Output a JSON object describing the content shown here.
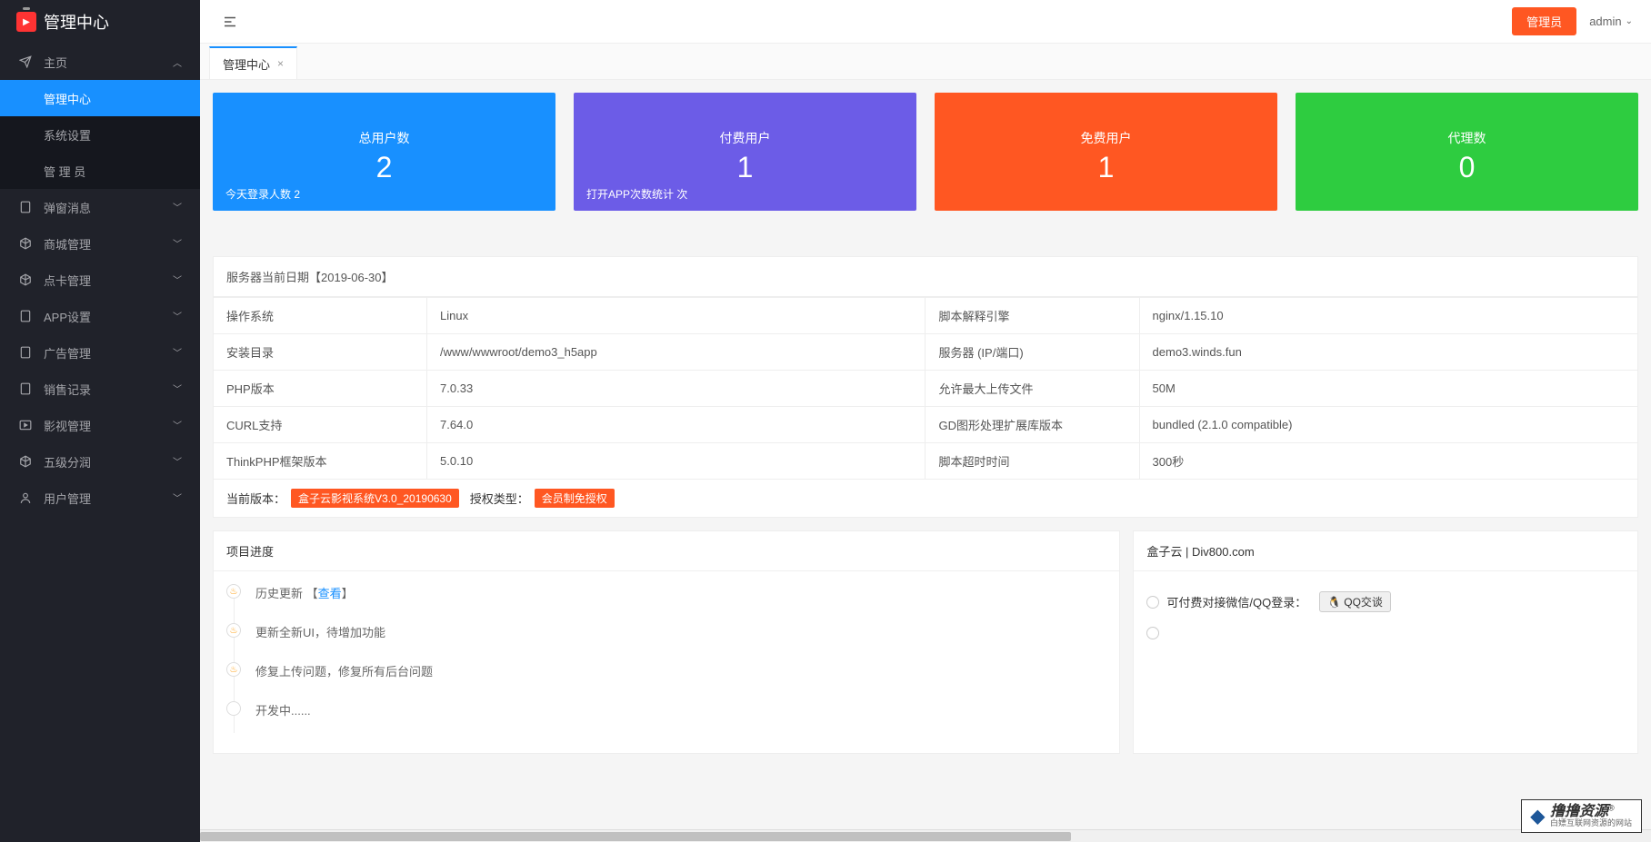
{
  "logo": {
    "title": "管理中心"
  },
  "sidebar": {
    "home": {
      "label": "主页",
      "expanded": true
    },
    "home_children": [
      {
        "label": "管理中心",
        "active": true
      },
      {
        "label": "系统设置"
      },
      {
        "label": "管 理 员"
      }
    ],
    "items": [
      {
        "label": "弹窗消息"
      },
      {
        "label": "商城管理"
      },
      {
        "label": "点卡管理"
      },
      {
        "label": "APP设置"
      },
      {
        "label": "广告管理"
      },
      {
        "label": "销售记录"
      },
      {
        "label": "影视管理"
      },
      {
        "label": "五级分润"
      },
      {
        "label": "用户管理"
      }
    ]
  },
  "topbar": {
    "admin_btn": "管理员",
    "user": "admin"
  },
  "tabs": [
    {
      "label": "管理中心",
      "closable": true,
      "active": true
    }
  ],
  "stats": [
    {
      "label": "总用户数",
      "value": "2",
      "sub": "今天登录人数 2",
      "color": "blue"
    },
    {
      "label": "付费用户",
      "value": "1",
      "sub": "打开APP次数统计 次",
      "color": "purple"
    },
    {
      "label": "免费用户",
      "value": "1",
      "sub": "",
      "color": "orange"
    },
    {
      "label": "代理数",
      "value": "0",
      "sub": "",
      "color": "green"
    }
  ],
  "server_info": {
    "header": "服务器当前日期【2019-06-30】",
    "rows": [
      {
        "k1": "操作系统",
        "v1": "Linux",
        "k2": "脚本解释引擎",
        "v2": "nginx/1.15.10"
      },
      {
        "k1": "安装目录",
        "v1": "/www/wwwroot/demo3_h5app",
        "k2": "服务器 (IP/端口)",
        "v2": "demo3.winds.fun"
      },
      {
        "k1": "PHP版本",
        "v1": "7.0.33",
        "k2": "允许最大上传文件",
        "v2": "50M"
      },
      {
        "k1": "CURL支持",
        "v1": "7.64.0",
        "k2": "GD图形处理扩展库版本",
        "v2": "bundled (2.1.0 compatible)"
      },
      {
        "k1": "ThinkPHP框架版本",
        "v1": "5.0.10",
        "k2": "脚本超时时间",
        "v2": "300秒"
      }
    ],
    "version_label": "当前版本：",
    "version_value": "盒子云影视系统V3.0_20190630",
    "auth_label": "授权类型：",
    "auth_value": "会员制免授权"
  },
  "progress": {
    "title": "项目进度",
    "items": [
      {
        "prefix": "历史更新 【",
        "link": "查看",
        "suffix": "】",
        "hot": true
      },
      {
        "text": "更新全新UI，待增加功能",
        "hot": true
      },
      {
        "text": "修复上传问题，修复所有后台问题",
        "hot": true
      },
      {
        "text": "开发中......",
        "hot": false
      }
    ]
  },
  "box_panel": {
    "title": "盒子云 | Div800.com",
    "contact_label": "可付费对接微信/QQ登录：",
    "qq_btn": "QQ交谈"
  },
  "watermark": {
    "main": "撸撸资源",
    "reg": "®",
    "sub": "白嫖互联网资源的网站"
  }
}
